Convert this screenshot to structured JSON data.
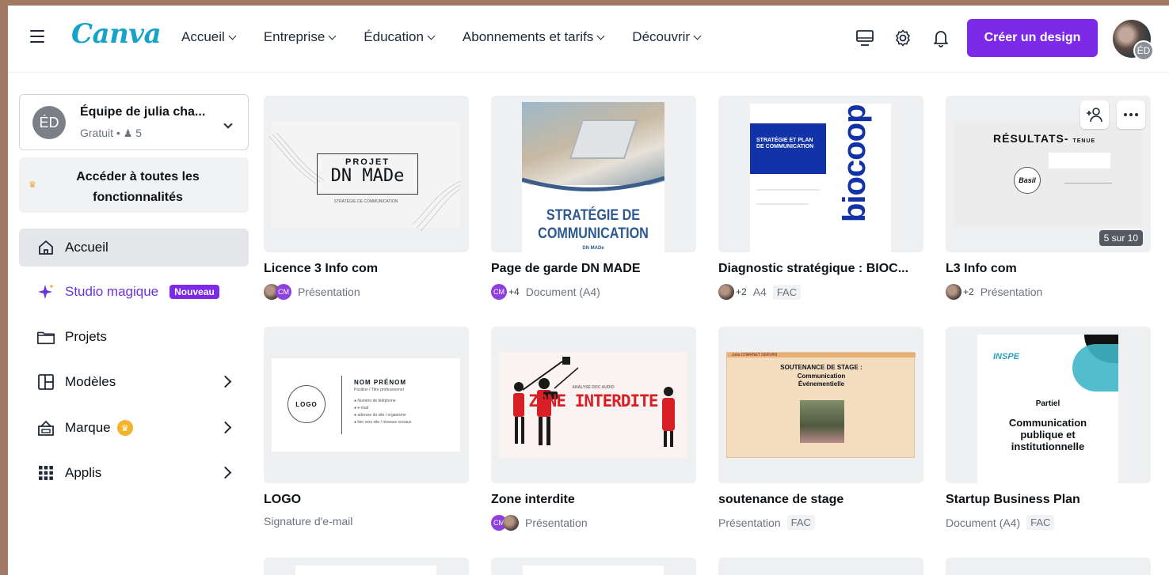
{
  "header": {
    "logo": "Canva",
    "nav": [
      "Accueil",
      "Entreprise",
      "Éducation",
      "Abonnements et tarifs",
      "Découvrir"
    ],
    "create_button": "Créer un design",
    "avatar_initials": "ÉD"
  },
  "sidebar": {
    "team": {
      "initials": "ÉD",
      "name": "Équipe de julia cha...",
      "plan": "Gratuit • ",
      "members": "5"
    },
    "upgrade": "Accéder à toutes les fonctionnalités",
    "items": [
      {
        "label": "Accueil",
        "icon": "home-icon"
      },
      {
        "label": "Studio magique",
        "icon": "sparkle-icon",
        "badge": "Nouveau"
      },
      {
        "label": "Projets",
        "icon": "folder-icon"
      },
      {
        "label": "Modèles",
        "icon": "template-icon"
      },
      {
        "label": "Marque",
        "icon": "brand-icon"
      },
      {
        "label": "Applis",
        "icon": "apps-grid-icon"
      }
    ]
  },
  "designs": [
    {
      "title": "Licence 3 Info com",
      "type": "Présentation",
      "thumb_title_top": "PROJET",
      "thumb_title": "DN MADe",
      "thumb_sub": "STRATÉGIE DE COMMUNICATION"
    },
    {
      "title": "Page de garde DN MADE",
      "type": "Document (A4)",
      "shared": "+4",
      "thumb_heading": "STRATÉGIE DE COMMUNICATION",
      "thumb_sub": "DN MADe"
    },
    {
      "title": "Diagnostic stratégique : BIOC...",
      "type": "A4",
      "shared": "+2",
      "tag": "FAC",
      "thumb_box": "STRATÉGIE ET PLAN DE COMMUNICATION",
      "thumb_brand": "biocoop"
    },
    {
      "title": "L3 Info com",
      "type": "Présentation",
      "shared": "+2",
      "pager": "5 sur 10",
      "thumb_title": "RÉSULTATS-",
      "thumb_title_small": "TENUE",
      "thumb_logo": "Basil"
    },
    {
      "title": "LOGO",
      "type": "Signature d'e-mail",
      "thumb_logo": "LOGO",
      "thumb_name": "NOM PRÉNOM",
      "thumb_job": "Position / Titre professionnel",
      "thumb_lines": [
        "Numéro de téléphone",
        "e-mail",
        "adresse du site / organisme",
        "lien vers site / réseaux sociaux"
      ]
    },
    {
      "title": "Zone interdite",
      "type": "Présentation",
      "thumb_kicker": "ANALYSE DOC AUDIO",
      "thumb_title": "ZONE INTERDITE"
    },
    {
      "title": "soutenance de stage",
      "type": "Présentation",
      "tag": "FAC",
      "thumb_author": "Julia CHARNET SERVAN",
      "thumb_title": "SOUTENANCE DE STAGE :",
      "thumb_sub": "Communication Événementielle"
    },
    {
      "title": "Startup Business Plan",
      "type": "Document (A4)",
      "tag": "FAC",
      "thumb_logo": "INSPE",
      "thumb_kicker": "Partiel",
      "thumb_title": "Communication publique et institutionnelle"
    }
  ],
  "colors": {
    "accent": "#7d2ae8",
    "logo": "#16a3c9",
    "frame": "#a27a63"
  }
}
